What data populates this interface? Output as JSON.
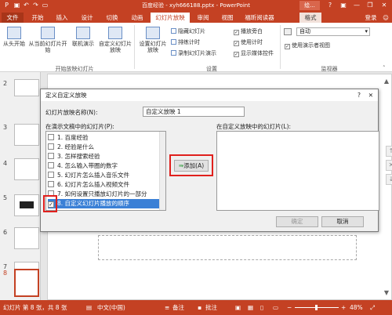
{
  "window": {
    "title": "百度经验 - xyh666188.pptx - PowerPoint",
    "short_label": "绘...",
    "help_glyph": "?",
    "minimize_glyph": "—",
    "restore_glyph": "❐",
    "close_glyph": "✕"
  },
  "ribbon_tabs": [
    "文件",
    "开始",
    "插入",
    "设计",
    "切换",
    "动画",
    "幻灯片放映",
    "审阅",
    "视图",
    "福昕阅读器",
    "格式"
  ],
  "login_label": "登录",
  "ribbon": {
    "start_from_beginning": "从头开始",
    "start_from_current": "从当前幻灯片开始",
    "online_present": "联机演示",
    "custom_slideshow": "自定义幻灯片放映",
    "group_start": "开始放映幻灯片",
    "setup_slideshow": "设置幻灯片放映",
    "hide_slide": "隐藏幻灯片",
    "rehearse_timings": "排练计时",
    "record_slideshow": "录制幻灯片演示",
    "play_narration": "播放旁白",
    "use_timings": "使用计时",
    "show_media_controls": "显示媒体控件",
    "group_setup": "设置",
    "monitor_value": "自动",
    "use_presenter_view": "使用演示者视图",
    "group_monitor": "监视器"
  },
  "thumbnails": {
    "numbers": [
      "2",
      "3",
      "4",
      "5",
      "6",
      "7",
      "8"
    ]
  },
  "dialog": {
    "title": "定义自定义放映",
    "name_label": "幻灯片放映名称(N):",
    "name_value": "自定义放映 1",
    "left_label": "在演示文稿中的幻灯片(P):",
    "right_label": "在自定义放映中的幻灯片(L):",
    "slides": [
      {
        "label": "1. 百度经验",
        "checked": false
      },
      {
        "label": "2. 经验是什么",
        "checked": false
      },
      {
        "label": "3. 怎样搜索经验",
        "checked": false
      },
      {
        "label": "4. 怎么输入带圈的数字",
        "checked": false
      },
      {
        "label": "5. 幻灯片怎么插入音乐文件",
        "checked": false
      },
      {
        "label": "6. 幻灯片怎么插入视频文件",
        "checked": false
      },
      {
        "label": "7. 如何设置只播放幻灯片的一部分",
        "checked": false
      },
      {
        "label": "8. 自定义幻灯片播放的顺序",
        "checked": true
      }
    ],
    "add_button": "添加(A)",
    "up_glyph": "↑",
    "remove_glyph": "✕",
    "down_glyph": "↓",
    "ok_button": "确定",
    "cancel_button": "取消",
    "close_glyph": "✕",
    "help_glyph": "?"
  },
  "status": {
    "slide_info": "幻灯片 第 8 张，共 8 张",
    "language": "中文(中国)",
    "notes": "备注",
    "comments": "批注",
    "zoom": "48%"
  },
  "colors": {
    "accent": "#c44123",
    "highlight": "#e0201d",
    "selected": "#3a80d6"
  }
}
